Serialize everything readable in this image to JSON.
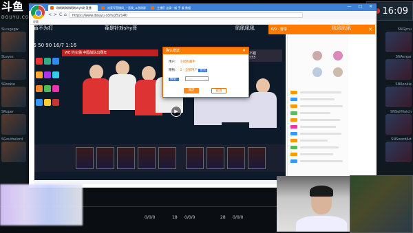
{
  "overlay": {
    "logo_main": "斗鱼",
    "logo_sub": "DOUYU.COM",
    "clock": "16:09",
    "caster_names": [
      "一直不为打",
      "葆是针对shy哥",
      "吼吼吼吼",
      "吼吼吼吼"
    ],
    "score": "25 50 90 16/7 1:16",
    "left_champions": [
      "SLcxgsgw",
      "SLeyes",
      "SRookie",
      "SRuper",
      "SGouthelord"
    ],
    "right_champions": [
      "SNGjmu",
      "SNAsrgar",
      "SNRookie",
      "SNSelfHatch",
      "SNSwordArt"
    ],
    "hud_stats": [
      "0/0/0",
      "18",
      "0/0/0",
      "28",
      "0/0/0"
    ]
  },
  "browser": {
    "tabs": [
      {
        "label": "刷刷刷刷刷刷刷shyh刷 直播",
        "active": true
      },
      {
        "label": "肖家军直播间_一直我_斗鱼刷屏",
        "active": false
      },
      {
        "label": "主播们 这录一般 手 看 数据",
        "active": false
      }
    ],
    "window_controls": "— □ ✕",
    "nav_back": "<",
    "nav_forward": ">",
    "nav_reload": "C",
    "nav_home": "⌂",
    "url": "https://www.douyu.com/252140",
    "bookmark_label": "收藏"
  },
  "stream": {
    "title_banner": "WE 约女偶 中国战队出赛年",
    "right_banner": "吼吼不错",
    "right_banner_num": "233333"
  },
  "side_popup": {
    "title": "0/9 · 暂停"
  },
  "dialog": {
    "title": "确认赠送",
    "user_label": "用户:",
    "user_value": "小奶狗最牛",
    "gift_label": "赠物:",
    "gift_value": "2 - 全部用户",
    "gift_highlight": "鱼丸",
    "qty_label": "数量:",
    "qty_value": "200",
    "confirm": "确定",
    "cancel": "取消"
  }
}
